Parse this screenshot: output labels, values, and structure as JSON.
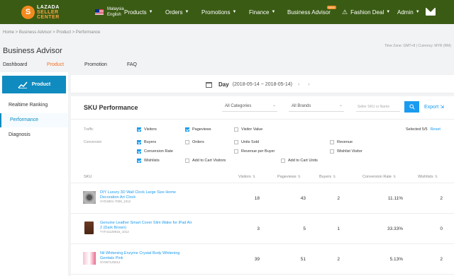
{
  "brand": {
    "logo_letter": "S",
    "line1": "LAZADA",
    "line2": "SELLER",
    "line3": "CENTER"
  },
  "region": {
    "country": "Malaysia",
    "language": "English"
  },
  "nav": [
    {
      "label": "Products"
    },
    {
      "label": "Orders"
    },
    {
      "label": "Promotions"
    },
    {
      "label": "Finance"
    },
    {
      "label": "Business Advisor",
      "badge": "NEW"
    },
    {
      "label": "Fashion Deal"
    },
    {
      "label": "Admin"
    }
  ],
  "breadcrumb": "Home  >  Business Advisor  >  Product  >  Performance",
  "page_title": "Business Advisor",
  "timezone": "Time Zone: GMT+8 | Currency: MYR (RM)",
  "subtabs": [
    "Dashboard",
    "Product",
    "Promotion",
    "FAQ"
  ],
  "sidebar": {
    "button": "Product",
    "items": [
      "Realtime Ranking",
      "Performance",
      "Diagnosis"
    ]
  },
  "datebar": {
    "day": "Day",
    "range": "(2018-05-14 ~ 2018-05-14)"
  },
  "sku": {
    "title": "SKU Performance",
    "category_select": "All Categories",
    "brand_select": "All Brands",
    "search_placeholder": "Seller SKU or Name",
    "export": "Export",
    "traffic_label": "Traffic",
    "conversion_label": "Conversion",
    "selected": "Selected 5/5",
    "reset": "Reset",
    "traffic": [
      {
        "label": "Visitors",
        "on": true
      },
      {
        "label": "Pageviews",
        "on": true
      },
      {
        "label": "Visitor Value",
        "on": false
      }
    ],
    "conversion": [
      {
        "label": "Buyers",
        "on": true
      },
      {
        "label": "Orders",
        "on": false
      },
      {
        "label": "Units Sold",
        "on": false
      },
      {
        "label": "Revenue",
        "on": false
      },
      {
        "label": "Conversion Rate",
        "on": true
      },
      {
        "label": "Revenue per Buyer",
        "on": false
      },
      {
        "label": "Wishlist Visitor",
        "on": false
      },
      {
        "label": "Wishlists",
        "on": true
      },
      {
        "label": "Add to Cart Visitors",
        "on": false
      },
      {
        "label": "Add to Cart Units",
        "on": false
      }
    ],
    "columns": [
      "SKU",
      "Visitors",
      "Pageviews",
      "Buyers",
      "Conversion Rate",
      "Wishlists"
    ],
    "rows": [
      {
        "name": "DIY Luxury 3D Wall Clock Large Size Home Decoration Art Clock",
        "id": "XYD4801-7009_1012",
        "visitors": "18",
        "pageviews": "43",
        "buyers": "2",
        "conversion": "11.11%",
        "wishlists": "2"
      },
      {
        "name": "Genuine Leather Smart Cover Slim Wake for iPad Air 2 (Dark Brown)",
        "id": "TYF41129916_1012",
        "visitors": "3",
        "pageviews": "5",
        "buyers": "1",
        "conversion": "33.33%",
        "wishlists": "0"
      },
      {
        "name": "Nil Whitening Enzyme Crystal Body Whitening Genitals Pink",
        "id": "SY087125012",
        "visitors": "39",
        "pageviews": "51",
        "buyers": "2",
        "conversion": "5.13%",
        "wishlists": "2"
      }
    ]
  },
  "colors": {
    "topbar": "#3a5b14",
    "accent": "#f57224",
    "primary": "#0f8bbf",
    "link": "#1a9bf0"
  }
}
